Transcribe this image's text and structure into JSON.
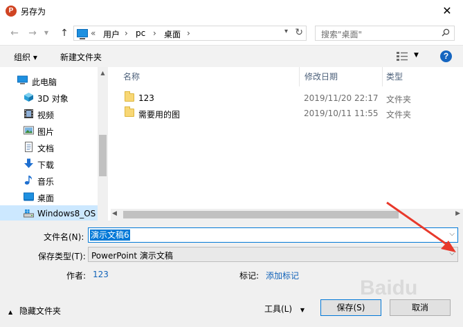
{
  "window": {
    "title": "另存为",
    "app_icon_letter": "P"
  },
  "nav": {
    "breadcrumb": [
      "«",
      "用户",
      "pc",
      "桌面"
    ],
    "search_placeholder": "搜索\"桌面\""
  },
  "toolbar": {
    "organize": "组织 ▾",
    "new_folder": "新建文件夹"
  },
  "sidebar": {
    "items": [
      {
        "label": "此电脑",
        "icon": "computer-icon"
      },
      {
        "label": "3D 对象",
        "icon": "cube-icon"
      },
      {
        "label": "视频",
        "icon": "video-icon"
      },
      {
        "label": "图片",
        "icon": "picture-icon"
      },
      {
        "label": "文档",
        "icon": "document-icon"
      },
      {
        "label": "下载",
        "icon": "download-icon"
      },
      {
        "label": "音乐",
        "icon": "music-icon"
      },
      {
        "label": "桌面",
        "icon": "desktop-icon"
      },
      {
        "label": "Windows8_OS",
        "icon": "drive-icon"
      }
    ]
  },
  "columns": {
    "name": "名称",
    "date": "修改日期",
    "type": "类型"
  },
  "files": [
    {
      "name": "123",
      "date": "2019/11/20 22:17",
      "type": "文件夹"
    },
    {
      "name": "需要用的图",
      "date": "2019/10/11 11:55",
      "type": "文件夹"
    }
  ],
  "form": {
    "filename_label": "文件名(N):",
    "filename_value": "演示文稿6",
    "filetype_label": "保存类型(T):",
    "filetype_value": "PowerPoint 演示文稿",
    "author_label": "作者:",
    "author_value": "123",
    "tags_label": "标记:",
    "tags_value": "添加标记"
  },
  "footer": {
    "hide_folders": "隐藏文件夹",
    "tools": "工具(L)",
    "save": "保存(S)",
    "cancel": "取消"
  },
  "watermark": "Baidu",
  "colors": {
    "accent": "#0078d7",
    "link": "#1062b8",
    "annotation_arrow": "#e8392b"
  }
}
